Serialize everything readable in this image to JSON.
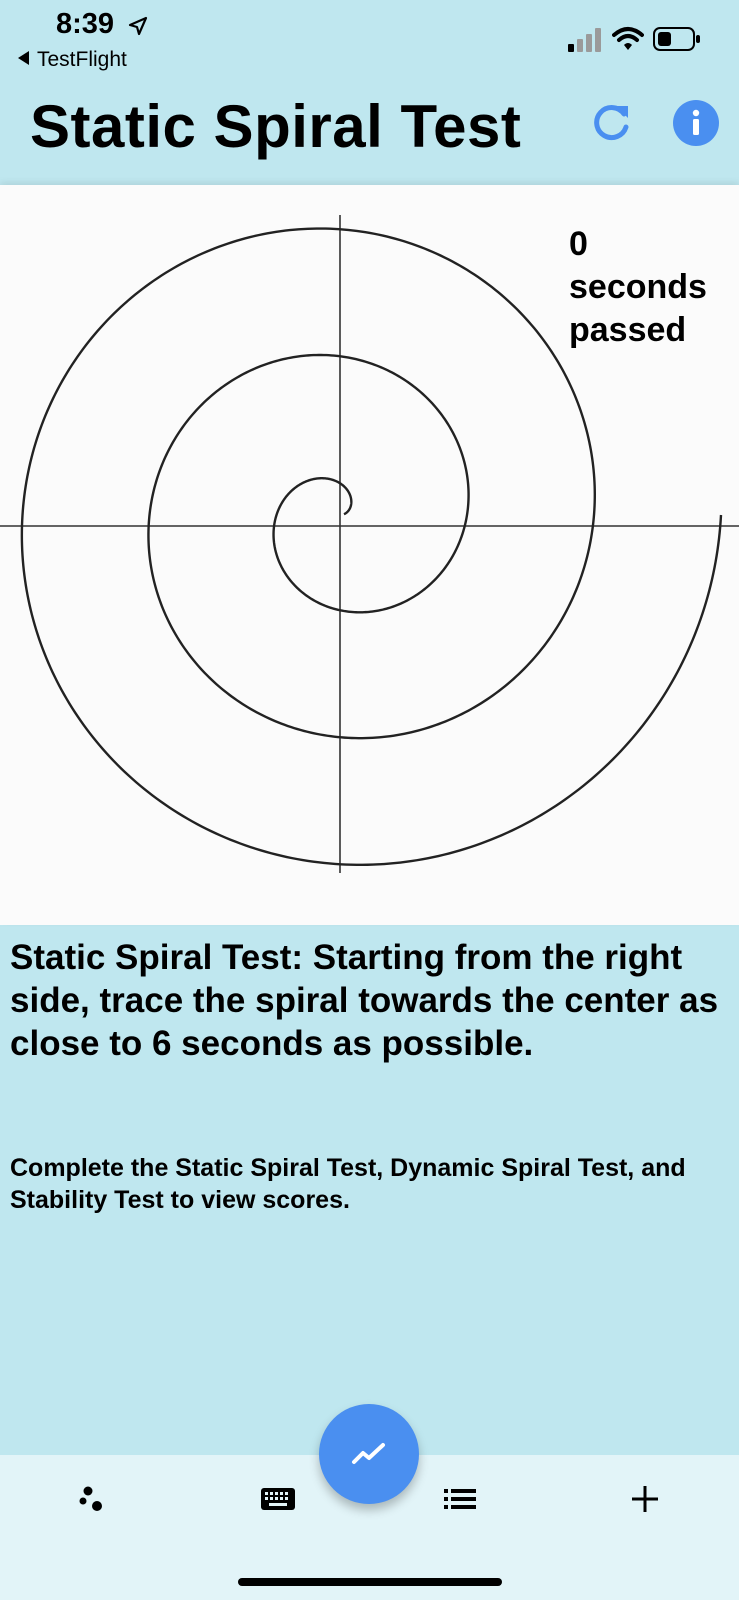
{
  "status_bar": {
    "time": "8:39",
    "back_app": "TestFlight",
    "icons": [
      "location-arrow-icon",
      "signal-icon",
      "wifi-icon",
      "battery-icon"
    ]
  },
  "header": {
    "title": "Static Spiral Test",
    "refresh_icon": "refresh-icon",
    "info_icon": "info-icon"
  },
  "canvas": {
    "timer_value": "0",
    "timer_line2": "seconds",
    "timer_line3": "passed"
  },
  "instructions": {
    "main": "Static Spiral Test: Starting from the right side, trace the spiral towards the center as close to 6 seconds as possible.",
    "scores_note": "Complete the Static Spiral Test, Dynamic Spiral Test, and Stability Test to view scores."
  },
  "bottom_nav": {
    "items": [
      {
        "icon": "bubbles-icon"
      },
      {
        "icon": "keyboard-icon"
      },
      {
        "icon": "trend-chart-icon"
      },
      {
        "icon": "list-icon"
      },
      {
        "icon": "plus-icon"
      }
    ]
  },
  "colors": {
    "background": "#bfe7ef",
    "accent": "#4a8ff0",
    "canvas": "#fbfbfb",
    "nav_bar": "#e2f4f8"
  }
}
